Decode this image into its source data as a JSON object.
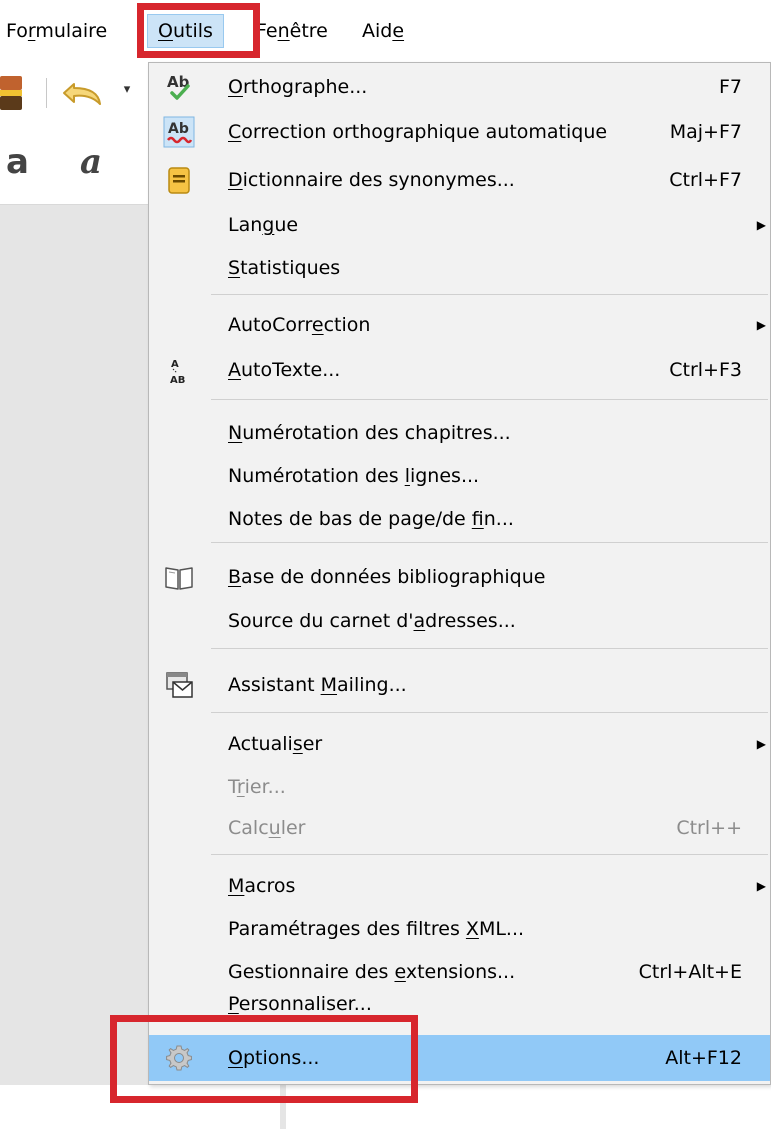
{
  "menubar": {
    "formulaire": {
      "before": "Fo",
      "mnemonic": "r",
      "after": "mulaire"
    },
    "outils": {
      "before": "",
      "mnemonic": "O",
      "after": "utils"
    },
    "fenetre": {
      "before": "Fe",
      "mnemonic": "n",
      "after": "être"
    },
    "aide": {
      "before": "Aid",
      "mnemonic": "e",
      "after": ""
    }
  },
  "menu": {
    "orthographe": {
      "before": "",
      "mnemonic": "O",
      "after": "rthographe...",
      "shortcut": "F7"
    },
    "correction": {
      "before": "",
      "mnemonic": "C",
      "after": "orrection orthographique automatique",
      "shortcut": "Maj+F7"
    },
    "dictionnaire": {
      "before": "",
      "mnemonic": "D",
      "after": "ictionnaire des synonymes...",
      "shortcut": "Ctrl+F7"
    },
    "langue": {
      "before": "Lan",
      "mnemonic": "g",
      "after": "ue"
    },
    "statistiques": {
      "before": "",
      "mnemonic": "S",
      "after": "tatistiques"
    },
    "autocorrection": {
      "before": "AutoCorr",
      "mnemonic": "e",
      "after": "ction"
    },
    "autotexte": {
      "before": "",
      "mnemonic": "A",
      "after": "utoTexte...",
      "shortcut": "Ctrl+F3"
    },
    "numchapitres": {
      "before": "",
      "mnemonic": "N",
      "after": "umérotation des chapitres..."
    },
    "numlignes": {
      "before": "Numérotation des ",
      "mnemonic": "l",
      "after": "ignes..."
    },
    "notes": {
      "before": "Notes de bas de page/de ",
      "mnemonic": "f",
      "after": "in..."
    },
    "biblio": {
      "before": "",
      "mnemonic": "B",
      "after": "ase de données bibliographique"
    },
    "carnet": {
      "before": "Source du carnet d'",
      "mnemonic": "a",
      "after": "dresses..."
    },
    "mailing": {
      "before": "Assistant ",
      "mnemonic": "M",
      "after": "ailing..."
    },
    "actualiser": {
      "before": "Actuali",
      "mnemonic": "s",
      "after": "er"
    },
    "trier": {
      "before": "T",
      "mnemonic": "r",
      "after": "ier..."
    },
    "calculer": {
      "before": "Calc",
      "mnemonic": "u",
      "after": "ler",
      "shortcut": "Ctrl++"
    },
    "macros": {
      "before": "",
      "mnemonic": "M",
      "after": "acros"
    },
    "filtres": {
      "before": "Paramétrages des filtres ",
      "mnemonic": "X",
      "after": "ML..."
    },
    "extensions": {
      "before": "Gestionnaire des ",
      "mnemonic": "e",
      "after": "xtensions...",
      "shortcut": "Ctrl+Alt+E"
    },
    "personnaliser": {
      "before": "",
      "mnemonic": "P",
      "after": "ersonnaliser..."
    },
    "options": {
      "before": "",
      "mnemonic": "O",
      "after": "ptions...",
      "shortcut": "Alt+F12"
    }
  },
  "colors": {
    "highlight": "#91c9f7",
    "menu_bg": "#f2f2f2",
    "annotation": "#d7262d",
    "disabled_text": "#8c8c8c"
  },
  "icons": {
    "orthographe": "spellcheck-icon",
    "correction": "auto-spellcheck-icon",
    "dictionnaire": "thesaurus-icon",
    "autotexte": "autotext-icon",
    "biblio": "book-icon",
    "mailing": "mail-merge-icon",
    "options": "gear-icon"
  }
}
